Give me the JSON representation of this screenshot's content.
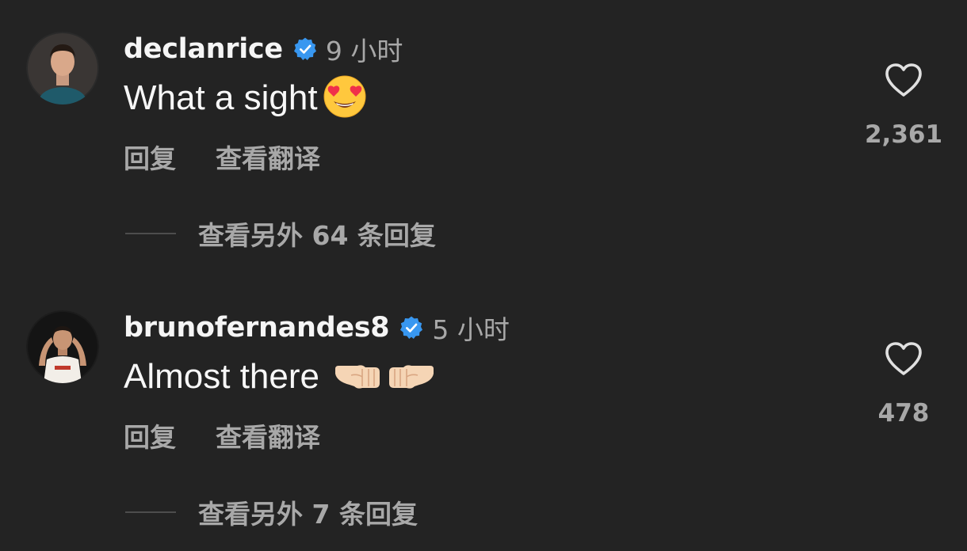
{
  "comments": [
    {
      "username": "declanrice",
      "verified": true,
      "timestamp": "9 小时",
      "text": "What a sight",
      "emoji": "smiling-face-with-heart-eyes",
      "reply_label": "回复",
      "translate_label": "查看翻译",
      "likes": "2,361",
      "more_replies": "查看另外 64 条回复"
    },
    {
      "username": "brunofernandes8",
      "verified": true,
      "timestamp": "5 小时",
      "text": "Almost there",
      "emoji": "fist-bump-left-and-right",
      "reply_label": "回复",
      "translate_label": "查看翻译",
      "likes": "478",
      "more_replies": "查看另外 7 条回复"
    }
  ],
  "colors": {
    "background": "#232323",
    "primary_text": "#f5f5f5",
    "secondary_text": "#a8a8a8",
    "verified_badge": "#3897f0"
  }
}
